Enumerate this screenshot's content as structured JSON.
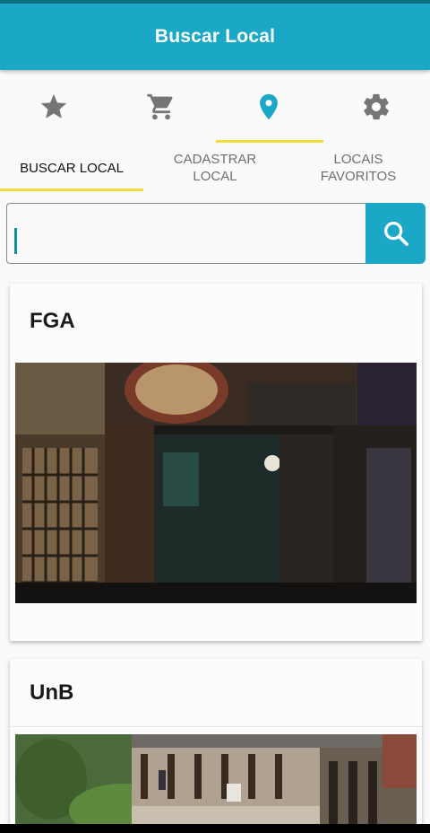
{
  "app_bar": {
    "title": "Buscar Local"
  },
  "icon_tabs": [
    {
      "icon": "star-icon",
      "selected": false
    },
    {
      "icon": "cart-icon",
      "selected": false
    },
    {
      "icon": "location-pin-icon",
      "selected": true
    },
    {
      "icon": "gear-icon",
      "selected": false
    }
  ],
  "text_tabs": [
    {
      "label": "BUSCAR LOCAL",
      "selected": true
    },
    {
      "label": "CADASTRAR LOCAL",
      "selected": false
    },
    {
      "label": "LOCAIS FAVORITOS",
      "selected": false
    }
  ],
  "search": {
    "value": "",
    "placeholder": "",
    "button_icon": "search-icon"
  },
  "places": [
    {
      "name": "FGA",
      "photo": "storefront-photo"
    },
    {
      "name": "UnB",
      "photo": "campus-walkway-photo"
    }
  ],
  "colors": {
    "primary": "#1aa8c6",
    "indicator": "#f2de3a",
    "icon_inactive": "#757575",
    "icon_active": "#1aa8c6"
  }
}
